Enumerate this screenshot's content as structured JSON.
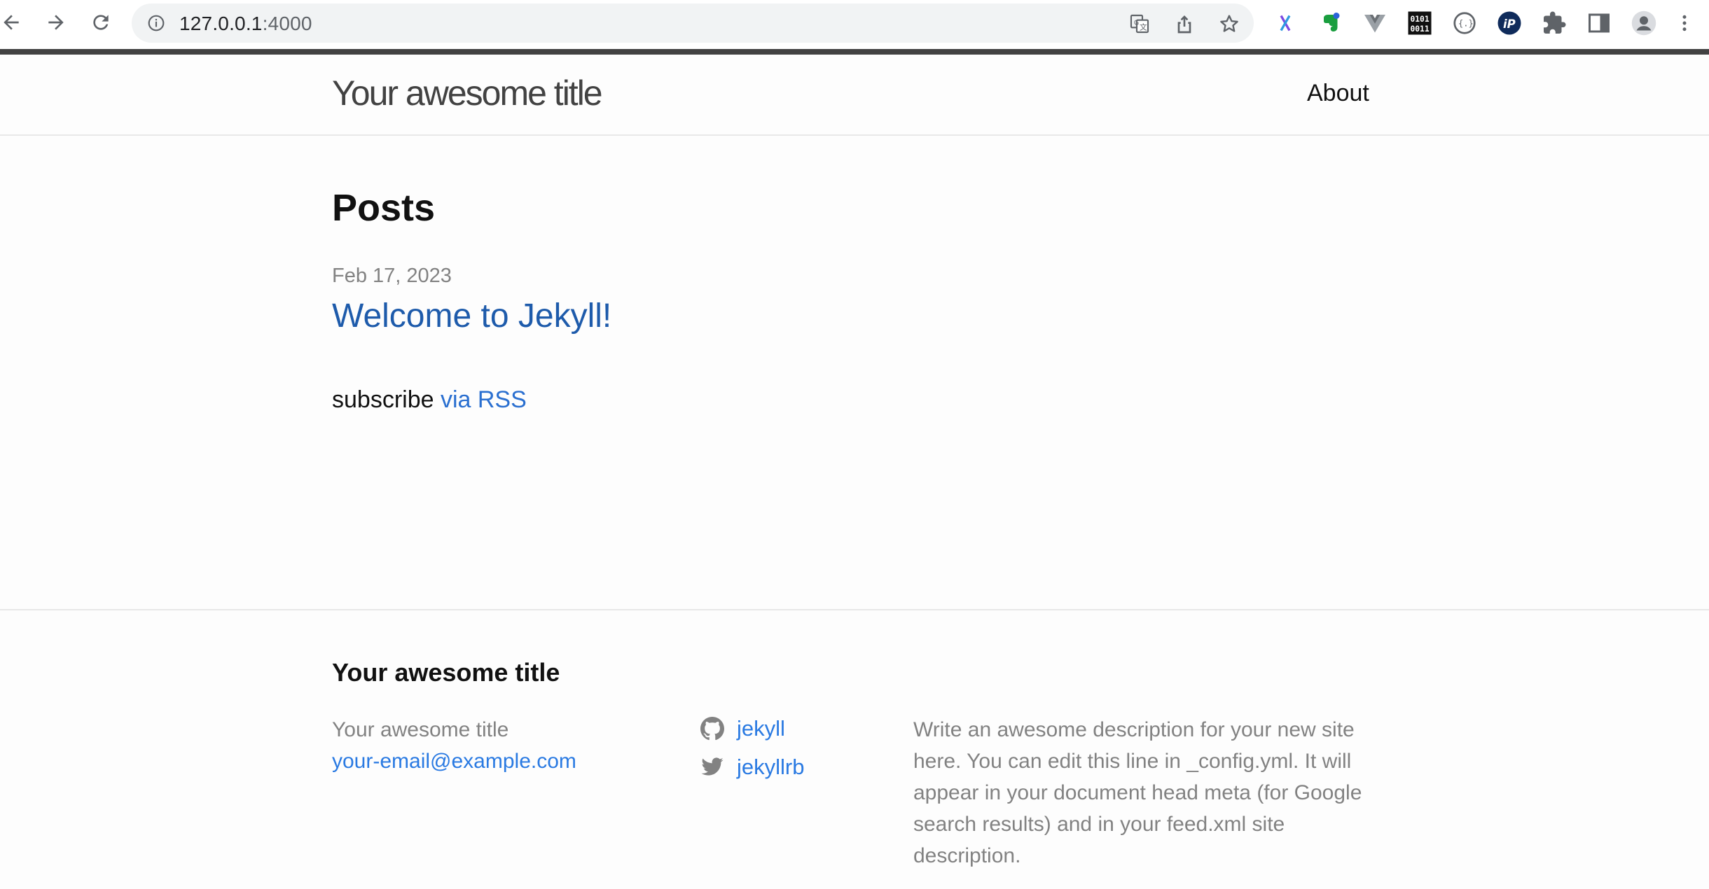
{
  "browser": {
    "url_host": "127.0.0.1",
    "url_port": ":4000",
    "icons": {
      "back": "arrow-left-icon",
      "forward": "arrow-right-icon",
      "reload": "reload-icon",
      "site_info": "info-icon",
      "translate": "translate-icon",
      "share": "share-icon",
      "bookmark": "star-icon",
      "profile": "avatar-icon",
      "menu": "kebab-menu-icon"
    },
    "extensions": [
      "x-extension-icon",
      "evernote-icon",
      "vue-devtools-icon",
      "binary-extension-icon",
      "json-extension-icon",
      "ip-extension-icon",
      "puzzle-extensions-icon",
      "side-panel-icon"
    ],
    "colors": {
      "chrome_divider": "#424242"
    }
  },
  "header": {
    "site_title": "Your awesome title",
    "nav": {
      "about": "About"
    }
  },
  "main": {
    "heading": "Posts",
    "posts": [
      {
        "date": "Feb 17, 2023",
        "title": "Welcome to Jekyll!"
      }
    ],
    "rss": {
      "prefix": "subscribe",
      "link": "via RSS"
    }
  },
  "footer": {
    "heading": "Your awesome title",
    "contact_name": "Your awesome title",
    "email": "your-email@example.com",
    "social": [
      {
        "icon": "github-icon",
        "username": "jekyll"
      },
      {
        "icon": "twitter-icon",
        "username": "jekyllrb"
      }
    ],
    "description": "Write an awesome description for your new site here. You can edit this line in _config.yml. It will appear in your document head meta (for Google search results) and in your feed.xml site description."
  },
  "colors": {
    "link": "#2a7ae2",
    "muted": "#828282",
    "text": "#111111",
    "background": "#fdfdfd"
  }
}
